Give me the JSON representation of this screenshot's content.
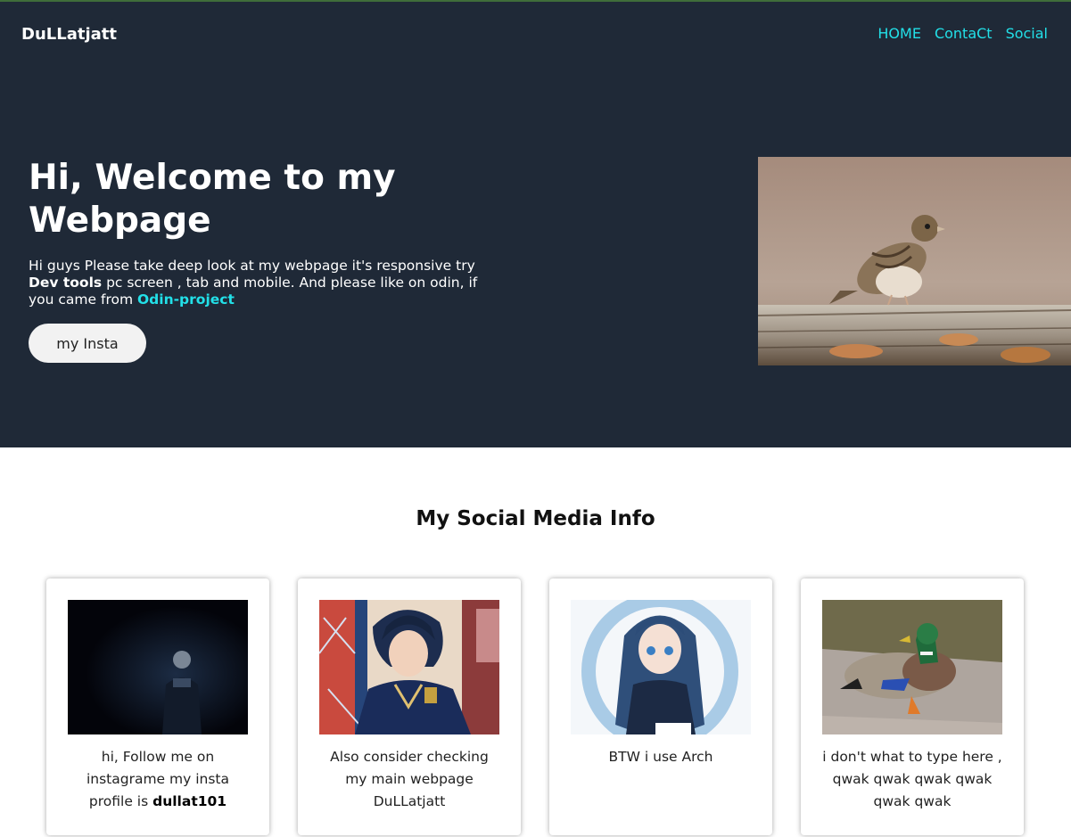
{
  "header": {
    "logo": "DuLLatjatt",
    "nav": [
      "HOME",
      "ContaCt",
      "Social"
    ]
  },
  "hero": {
    "title": "Hi, Welcome to my Webpage",
    "text_before_bold": "Hi guys Please take deep look at my webpage it's responsive try",
    "bold": "Dev tools",
    "text_after_bold": "pc screen , tab and mobile. And please like on odin, if you came from",
    "link": "Odin-project",
    "button": "my Insta",
    "image_icon": "sparrow-photo"
  },
  "social": {
    "title": "My Social Media Info",
    "cards": [
      {
        "icon": "man-in-dark-photo",
        "caption_before": "hi, Follow me on instagrame my insta profile is",
        "caption_bold": "dullat101"
      },
      {
        "icon": "anime-boy-illustration",
        "caption_before": "Also consider checking my main webpage DuLLatjatt",
        "caption_bold": ""
      },
      {
        "icon": "anime-girl-illustration",
        "caption_before": "BTW i use Arch",
        "caption_bold": ""
      },
      {
        "icon": "mallard-duck-photo",
        "caption_before": "i don't what to type here , qwak qwak qwak qwak qwak qwak",
        "caption_bold": ""
      }
    ]
  },
  "colors": {
    "hero_bg": "#1f2937",
    "accent": "#22e0e8"
  }
}
